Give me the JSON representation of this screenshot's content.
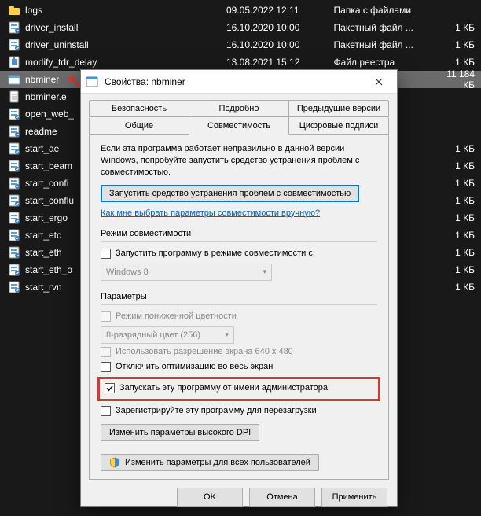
{
  "explorer": {
    "rows": [
      {
        "icon": "folder",
        "name": "logs",
        "date": "09.05.2022 12:11",
        "type": "Папка с файлами",
        "size": "",
        "selected": false
      },
      {
        "icon": "bat",
        "name": "driver_install",
        "date": "16.10.2020 10:00",
        "type": "Пакетный файл ...",
        "size": "1 КБ",
        "selected": false
      },
      {
        "icon": "bat",
        "name": "driver_uninstall",
        "date": "16.10.2020 10:00",
        "type": "Пакетный файл ...",
        "size": "1 КБ",
        "selected": false
      },
      {
        "icon": "reg",
        "name": "modify_tdr_delay",
        "date": "13.08.2021 15:12",
        "type": "Файл реестра",
        "size": "1 КБ",
        "selected": false
      },
      {
        "icon": "exe",
        "name": "nbminer",
        "date": "",
        "type": "",
        "size": "11 184 КБ",
        "selected": true
      },
      {
        "icon": "txt",
        "name": "nbminer.e",
        "date": "",
        "type": "",
        "size": "",
        "selected": false
      },
      {
        "icon": "bat",
        "name": "open_web_",
        "date": "",
        "type": "",
        "size": "",
        "selected": false
      },
      {
        "icon": "bat",
        "name": "readme",
        "date": "",
        "type": "",
        "size": "",
        "selected": false
      },
      {
        "icon": "bat",
        "name": "start_ae",
        "date": "",
        "type": "",
        "size": "1 КБ",
        "selected": false
      },
      {
        "icon": "bat",
        "name": "start_beam",
        "date": "",
        "type": "",
        "size": "1 КБ",
        "selected": false
      },
      {
        "icon": "bat",
        "name": "start_confi",
        "date": "",
        "type": "",
        "size": "1 КБ",
        "selected": false
      },
      {
        "icon": "bat",
        "name": "start_conflu",
        "date": "",
        "type": "",
        "size": "1 КБ",
        "selected": false
      },
      {
        "icon": "bat",
        "name": "start_ergo",
        "date": "",
        "type": "",
        "size": "1 КБ",
        "selected": false
      },
      {
        "icon": "bat",
        "name": "start_etc",
        "date": "",
        "type": "",
        "size": "1 КБ",
        "selected": false
      },
      {
        "icon": "bat",
        "name": "start_eth",
        "date": "",
        "type": "",
        "size": "1 КБ",
        "selected": false
      },
      {
        "icon": "bat",
        "name": "start_eth_o",
        "date": "",
        "type": "",
        "size": "1 КБ",
        "selected": false
      },
      {
        "icon": "bat",
        "name": "start_rvn",
        "date": "",
        "type": "",
        "size": "1 КБ",
        "selected": false
      }
    ]
  },
  "dialog": {
    "title": "Свойства: nbminer",
    "tabs": {
      "r1": [
        "Безопасность",
        "Подробно",
        "Предыдущие версии"
      ],
      "r2": [
        "Общие",
        "Совместимость",
        "Цифровые подписи"
      ],
      "active": "Совместимость"
    },
    "info": "Если эта программа работает неправильно в данной версии Windows, попробуйте запустить средство устранения проблем с совместимостью.",
    "troubleshoot_btn": "Запустить средство устранения проблем с совместимостью",
    "help_link": "Как мне выбрать параметры совместимости вручную?",
    "compat_mode": {
      "title": "Режим совместимости",
      "checkbox": "Запустить программу в режиме совместимости с:",
      "select_value": "Windows 8"
    },
    "params": {
      "title": "Параметры",
      "reduced_color": "Режим пониженной цветности",
      "color_select": "8-разрядный цвет (256)",
      "res640": "Использовать разрешение экрана 640 x 480",
      "disable_fullscreen_opt": "Отключить оптимизацию во весь экран",
      "run_as_admin": "Запускать эту программу от имени администратора",
      "register_restart": "Зарегистрируйте эту программу для перезагрузки",
      "dpi_btn": "Изменить параметры высокого DPI"
    },
    "all_users_btn": "Изменить параметры для всех пользователей",
    "buttons": {
      "ok": "OK",
      "cancel": "Отмена",
      "apply": "Применить"
    }
  }
}
